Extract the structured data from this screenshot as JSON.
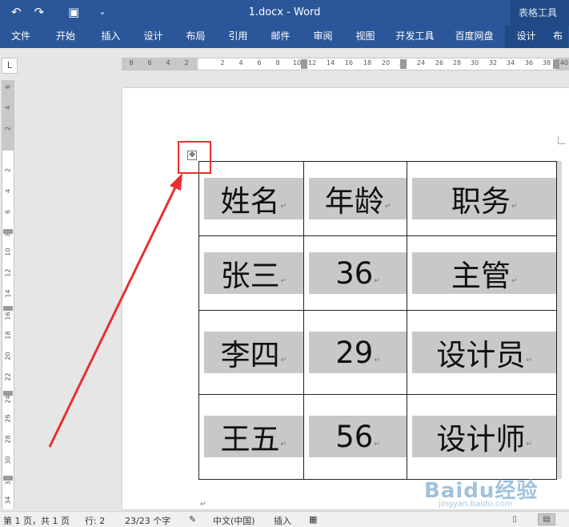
{
  "titlebar": {
    "title": "1.docx - Word",
    "context_tab": "表格工具",
    "qat": {
      "undo": "↶",
      "redo": "↷",
      "save": "▣",
      "customize": "⌄"
    }
  },
  "ribbon": {
    "tabs": [
      "文件",
      "开始",
      "插入",
      "设计",
      "布局",
      "引用",
      "邮件",
      "审阅",
      "视图",
      "开发工具",
      "百度网盘",
      "设计",
      "布"
    ]
  },
  "ruler": {
    "corner": "L",
    "horizontal_ticks": [
      "8",
      "6",
      "4",
      "2",
      "2",
      "4",
      "6",
      "8",
      "10",
      "12",
      "14",
      "16",
      "18",
      "20",
      "22",
      "24",
      "26",
      "28",
      "30",
      "32",
      "34",
      "36",
      "38",
      "40"
    ],
    "vertical_ticks": [
      "6",
      "4",
      "2",
      "2",
      "4",
      "6",
      "8",
      "10",
      "12",
      "14",
      "16",
      "18",
      "20",
      "22",
      "24",
      "26",
      "28",
      "30",
      "32",
      "34"
    ]
  },
  "table": {
    "rows": [
      [
        "姓名",
        "年龄",
        "职务"
      ],
      [
        "张三",
        "36",
        "主管"
      ],
      [
        "李四",
        "29",
        "设计员"
      ],
      [
        "王五",
        "56",
        "设计师"
      ]
    ],
    "paragraph_mark": "↵",
    "move_handle": "✥"
  },
  "statusbar": {
    "page": "第 1 页，共 1 页",
    "line": "行: 2",
    "words": "23/23 个字",
    "language": "中文(中国)",
    "mode": "插入"
  },
  "watermark": {
    "brand": "Baidu经验",
    "url": "jingyan.baidu.com"
  },
  "colors": {
    "ribbon": "#2b579a",
    "context": "#1f4a85",
    "highlight": "#e8302f",
    "cell_shading": "#c8c8c8"
  }
}
